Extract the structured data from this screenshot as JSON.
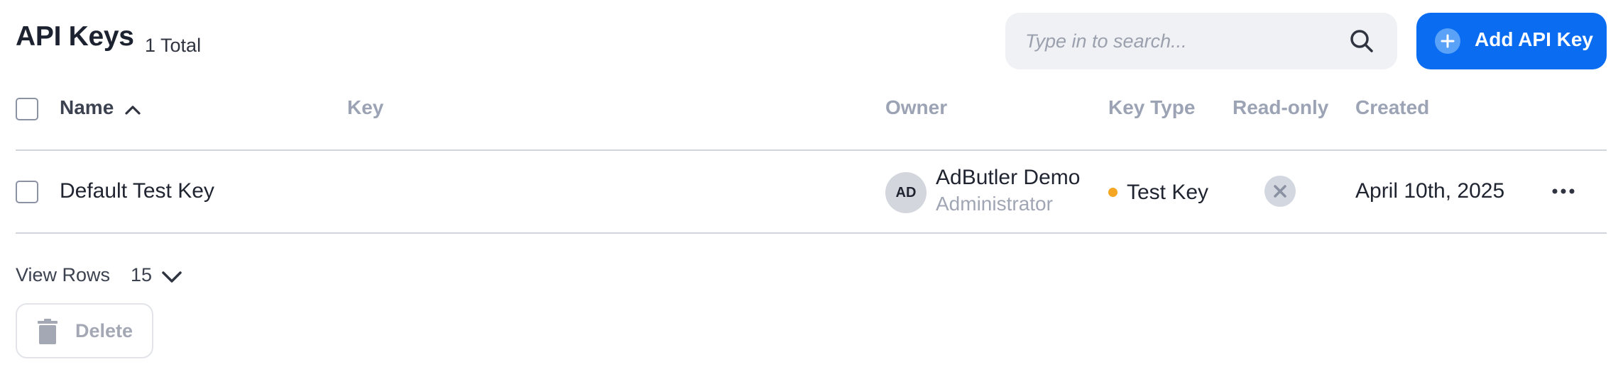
{
  "header": {
    "title": "API Keys",
    "total": "1 Total",
    "search_placeholder": "Type in to search...",
    "add_button_label": "Add API Key"
  },
  "table": {
    "columns": {
      "name": "Name",
      "key": "Key",
      "owner": "Owner",
      "key_type": "Key Type",
      "read_only": "Read-only",
      "created": "Created"
    },
    "sort": {
      "column": "Name",
      "direction": "ascending"
    },
    "rows": [
      {
        "name": "Default Test Key",
        "key": "",
        "owner_initials": "AD",
        "owner_name": "AdButler Demo",
        "owner_role": "Administrator",
        "key_type": "Test Key",
        "key_type_color": "#f5a623",
        "read_only": false,
        "read_only_icon": "x-icon",
        "created": "April 10th, 2025"
      }
    ]
  },
  "footer": {
    "view_rows_label": "View Rows",
    "view_rows_value": "15",
    "delete_label": "Delete"
  },
  "colors": {
    "accent": "#0a6cf1",
    "muted_text": "#9ba3b4",
    "divider": "#d2d5dc",
    "test_key_dot": "#f5a623"
  }
}
